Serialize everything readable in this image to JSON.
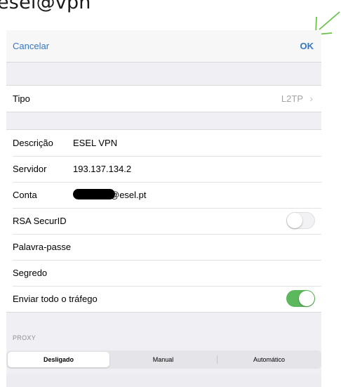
{
  "caption": "esel@vpn",
  "nav": {
    "cancel": "Cancelar",
    "ok": "OK"
  },
  "tipo": {
    "label": "Tipo",
    "value": "L2TP",
    "chevron": "›"
  },
  "fields": {
    "descricao": {
      "label": "Descrição",
      "value": "ESEL VPN"
    },
    "servidor": {
      "label": "Servidor",
      "value": "193.137.134.2"
    },
    "conta": {
      "label": "Conta",
      "value_suffix": "@esel.pt"
    },
    "rsa": {
      "label": "RSA SecurID",
      "enabled": false
    },
    "palavra_passe": {
      "label": "Palavra-passe"
    },
    "segredo": {
      "label": "Segredo"
    },
    "enviar": {
      "label": "Enviar todo o tráfego",
      "enabled": true
    }
  },
  "proxy": {
    "header": "PROXY",
    "options": [
      "Desligado",
      "Manual",
      "Automático"
    ],
    "selected": "Desligado"
  },
  "colors": {
    "accent": "#3478c4",
    "toggle_on": "#5cb85c",
    "annotation_arrow": "#6cc24a"
  }
}
